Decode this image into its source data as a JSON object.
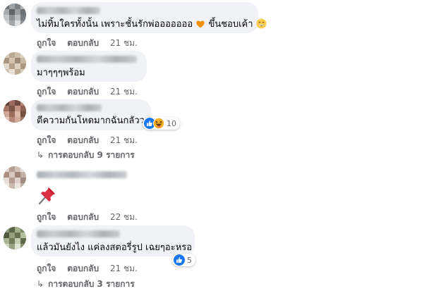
{
  "comments": [
    {
      "text": "ไม่ทิ้มใครทั้งนั้น เพราะชั้นรักพ่อออออออ",
      "text_after": "ขึ้นชอบเค้า",
      "like": "ถูกใจ",
      "reply": "ตอบกลับ",
      "time": "21 ชม."
    },
    {
      "text": "มาๆๆๆพร้อม",
      "like": "ถูกใจ",
      "reply": "ตอบกลับ",
      "time": "21 ชม."
    },
    {
      "text": "ตีความกันโหดมากฉันกลัวว",
      "reactions": "10",
      "like": "ถูกใจ",
      "reply": "ตอบกลับ",
      "time": "21 ชม.",
      "replies_label": "การตอบกลับ 9 รายการ"
    },
    {
      "like": "ถูกใจ",
      "reply": "ตอบกลับ",
      "time": "22 ชม."
    },
    {
      "text": "แล้วมันยังไง แค่ลงสตอรี่รูป เฉยๆอะหรอ",
      "reactions": "5",
      "like": "ถูกใจ",
      "reply": "ตอบกลับ",
      "time": "21 ชม.",
      "replies_label": "การตอบกลับ 3 รายการ"
    }
  ],
  "colors": {
    "bubble": "#f0f2f5",
    "meta": "#65676b",
    "text": "#050505",
    "like_blue": "#1877f2",
    "haha_yellow": "#f7b125"
  },
  "icons": [
    "orange-heart-icon",
    "grinning-emoji-icon",
    "like-reaction-icon",
    "haha-reaction-icon",
    "pushpin-icon",
    "reply-arrow-icon"
  ]
}
